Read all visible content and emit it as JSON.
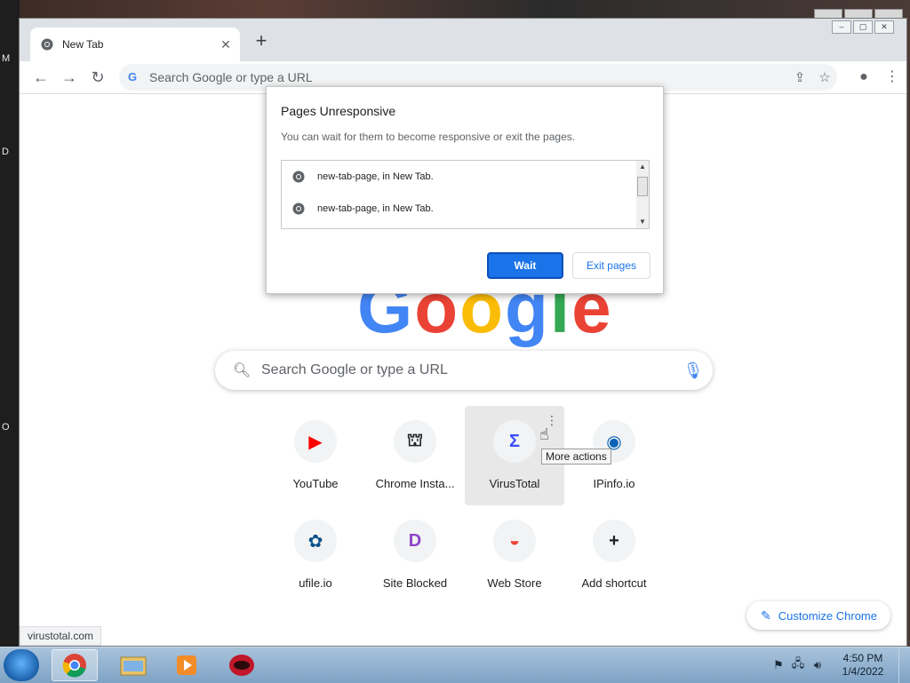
{
  "desktop": {
    "left_chars": [
      "M",
      "D",
      "O"
    ]
  },
  "browser": {
    "tab": {
      "title": "New Tab",
      "close": "✕"
    },
    "new_tab": "+",
    "caption": [
      "–",
      "▢",
      "✕"
    ],
    "omnibox": {
      "placeholder": "Search Google or type a URL",
      "g_letter": "G"
    },
    "nav": {
      "back": "←",
      "forward": "→",
      "reload": "↻"
    },
    "toolbar_icons": {
      "share": "⇪",
      "star": "☆",
      "profile": "●",
      "menu": "⋮"
    }
  },
  "dialog": {
    "title": "Pages Unresponsive",
    "message": "You can wait for them to become responsive or exit the pages.",
    "pages": [
      "new-tab-page, in New Tab.",
      "new-tab-page, in New Tab."
    ],
    "wait_label": "Wait",
    "exit_label": "Exit pages"
  },
  "ntp": {
    "search_placeholder": "Search Google or type a URL",
    "shortcuts": [
      {
        "label": "YouTube",
        "glyph": "▶",
        "color": "#ff0000"
      },
      {
        "label": "Chrome Insta...",
        "glyph": "⛫",
        "color": "#202124"
      },
      {
        "label": "VirusTotal",
        "glyph": "Σ",
        "color": "#394eff"
      },
      {
        "label": "IPinfo.io",
        "glyph": "◉",
        "color": "#0b63b6"
      },
      {
        "label": "ufile.io",
        "glyph": "✿",
        "color": "#0b4f8a"
      },
      {
        "label": "Site Blocked",
        "glyph": "D",
        "color": "#8e44c9"
      },
      {
        "label": "Web Store",
        "glyph": "◒",
        "color": "#ea4335"
      },
      {
        "label": "Add shortcut",
        "glyph": "+",
        "color": "#202124"
      }
    ],
    "tooltip": "More actions",
    "customize_label": "Customize Chrome",
    "status_url": "virustotal.com"
  },
  "taskbar": {
    "time": "4:50 PM",
    "date": "1/4/2022"
  }
}
